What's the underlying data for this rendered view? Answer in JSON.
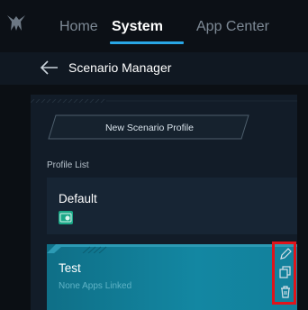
{
  "nav": {
    "tabs": [
      {
        "label": "Home"
      },
      {
        "label": "System"
      },
      {
        "label": "App Center"
      }
    ],
    "active_tab": "System"
  },
  "header": {
    "title": "Scenario Manager"
  },
  "main": {
    "new_profile_label": "New Scenario Profile",
    "list_label": "Profile List",
    "profiles": [
      {
        "name": "Default",
        "icon": "linked-app-icon"
      },
      {
        "name": "Test",
        "status": "None Apps Linked",
        "selected": true
      }
    ],
    "actions": [
      "edit-icon",
      "duplicate-icon",
      "delete-icon"
    ]
  },
  "colors": {
    "accent": "#29a7e6",
    "selected_card": "#1387a2",
    "app_icon": "#1ba787",
    "highlight_box": "#e0141a"
  }
}
